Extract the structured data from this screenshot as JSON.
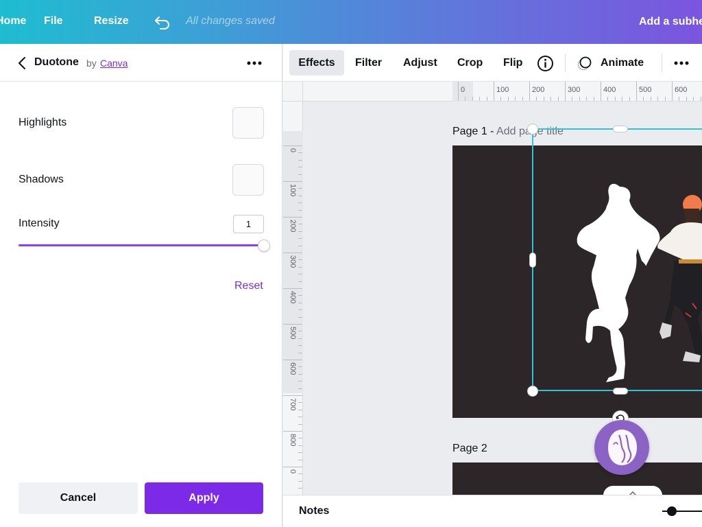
{
  "topbar": {
    "home_label": "Home",
    "file_label": "File",
    "resize_label": "Resize",
    "undo_icon": "undo-icon",
    "save_status": "All changes saved",
    "subheading_label": "Add a subheading"
  },
  "panel": {
    "title": "Duotone",
    "by_label": "by",
    "author_link": "Canva",
    "highlights_label": "Highlights",
    "shadows_label": "Shadows",
    "intensity_label": "Intensity",
    "intensity_value": "1",
    "intensity_fraction": 1.0,
    "reset_label": "Reset",
    "cancel_label": "Cancel",
    "apply_label": "Apply",
    "accent_color": "#7d2ae8",
    "highlights_color": "#fafafa",
    "shadows_color": "#fafafa"
  },
  "toolbar": {
    "effects_label": "Effects",
    "filter_label": "Filter",
    "adjust_label": "Adjust",
    "crop_label": "Crop",
    "flip_label": "Flip",
    "info_icon": "info-icon",
    "animate_label": "Animate",
    "more_icon": "more-icon"
  },
  "ruler": {
    "horizontal_ticks": [
      "0",
      "100",
      "200",
      "300",
      "400",
      "500",
      "600"
    ],
    "vertical_ticks": [
      "0",
      "100",
      "200",
      "300",
      "400",
      "500",
      "600",
      "700",
      "800",
      "0"
    ]
  },
  "canvas": {
    "page1_prefix": "Page 1 - ",
    "page1_title_placeholder": "Add page title",
    "page2_label": "Page 2",
    "page_bg_color": "#2c2628",
    "selection_color": "#2bc5d4"
  },
  "notes": {
    "notes_label": "Notes"
  }
}
